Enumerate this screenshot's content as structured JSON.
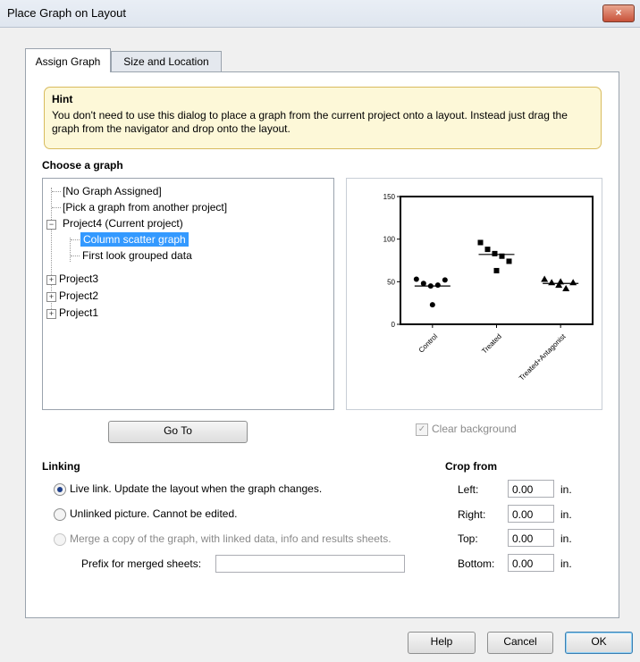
{
  "window": {
    "title": "Place Graph on Layout",
    "close_glyph": "×"
  },
  "tabs": [
    {
      "label": "Assign Graph",
      "active": true
    },
    {
      "label": "Size and Location",
      "active": false
    }
  ],
  "hint": {
    "title": "Hint",
    "text": "You don't need to use this dialog to place a graph from the current project onto a layout. Instead just drag the graph from the navigator and drop onto the layout."
  },
  "choose_graph": {
    "heading": "Choose a graph",
    "tree": [
      {
        "label": "[No Graph Assigned]",
        "level": 0,
        "expander": ""
      },
      {
        "label": "[Pick a graph from another project]",
        "level": 0,
        "expander": ""
      },
      {
        "label": "Project4 (Current project)",
        "level": 0,
        "expander": "−"
      },
      {
        "label": "Column scatter graph",
        "level": 1,
        "expander": "",
        "selected": true
      },
      {
        "label": "First look grouped data",
        "level": 1,
        "expander": ""
      },
      {
        "label": "Project3",
        "level": 0,
        "expander": "+"
      },
      {
        "label": "Project2",
        "level": 0,
        "expander": "+"
      },
      {
        "label": "Project1",
        "level": 0,
        "expander": "+"
      }
    ],
    "goto_label": "Go To",
    "clear_background_label": "Clear background",
    "clear_background_checked": true
  },
  "chart_data": {
    "type": "scatter",
    "categories": [
      "Control",
      "Treated",
      "Treated+Antagonist"
    ],
    "series": [
      {
        "category": "Control",
        "marker": "circle",
        "values": [
          53,
          48,
          45,
          46,
          52,
          23
        ],
        "mean": 45
      },
      {
        "category": "Treated",
        "marker": "square",
        "values": [
          96,
          88,
          83,
          80,
          74,
          63
        ],
        "mean": 82
      },
      {
        "category": "Treated+Antagonist",
        "marker": "triangle",
        "values": [
          53,
          49,
          46,
          42,
          49,
          50
        ],
        "mean": 48
      }
    ],
    "yticks": [
      0,
      50,
      100,
      150
    ],
    "ylim": [
      0,
      150
    ],
    "title": "",
    "xlabel": "",
    "ylabel": ""
  },
  "linking": {
    "heading": "Linking",
    "options": [
      {
        "label": "Live link. Update the layout when the graph changes.",
        "selected": true,
        "enabled": true
      },
      {
        "label": "Unlinked picture. Cannot be edited.",
        "selected": false,
        "enabled": true
      },
      {
        "label": "Merge a copy of the graph, with linked data, info and results sheets.",
        "selected": false,
        "enabled": false
      }
    ],
    "prefix_label": "Prefix for merged sheets:",
    "prefix_value": ""
  },
  "crop": {
    "heading": "Crop from",
    "unit": "in.",
    "fields": [
      {
        "label": "Left:",
        "value": "0.00"
      },
      {
        "label": "Right:",
        "value": "0.00"
      },
      {
        "label": "Top:",
        "value": "0.00"
      },
      {
        "label": "Bottom:",
        "value": "0.00"
      }
    ]
  },
  "footer": {
    "help_label": "Help",
    "cancel_label": "Cancel",
    "ok_label": "OK"
  }
}
